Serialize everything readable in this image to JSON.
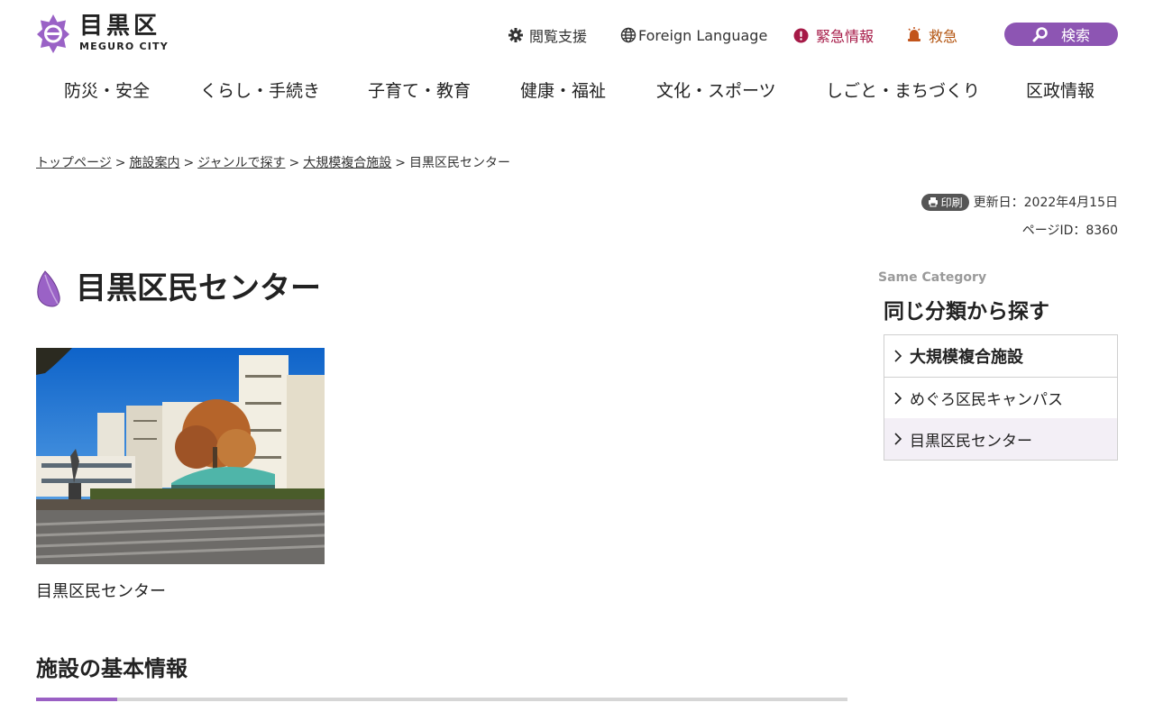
{
  "logo": {
    "jp": "目黒区",
    "en": "MEGURO CITY",
    "brand_color": "#8d55b3"
  },
  "header": {
    "access_label": "閲覧支援",
    "lang_label": "Foreign Language",
    "emergency_label": "緊急情報",
    "ambulance_label": "救急",
    "search_label": "検索"
  },
  "nav": [
    {
      "label": "防災・安全"
    },
    {
      "label": "くらし・手続き"
    },
    {
      "label": "子育て・教育"
    },
    {
      "label": "健康・福祉"
    },
    {
      "label": "文化・スポーツ"
    },
    {
      "label": "しごと・まちづくり"
    },
    {
      "label": "区政情報"
    }
  ],
  "breadcrumb": [
    {
      "label": "トップページ",
      "link": true
    },
    {
      "label": "施設案内",
      "link": true
    },
    {
      "label": "ジャンルで探す",
      "link": true
    },
    {
      "label": "大規模複合施設",
      "link": true
    },
    {
      "label": "目黒区民センター",
      "link": false
    }
  ],
  "breadcrumb_separator": ">",
  "meta": {
    "print_label": "印刷",
    "updated": "更新日：2022年4月15日",
    "page_id": "ページID：8360"
  },
  "page": {
    "title": "目黒区民センター",
    "image_caption": "目黒区民センター",
    "section_heading": "施設の基本情報"
  },
  "sidebar": {
    "eyebrow": "Same Category",
    "heading": "同じ分類から探す",
    "items": [
      {
        "label": "大規模複合施設"
      },
      {
        "label": "めぐろ区民キャンパス"
      },
      {
        "label": "目黒区民センター"
      }
    ]
  }
}
